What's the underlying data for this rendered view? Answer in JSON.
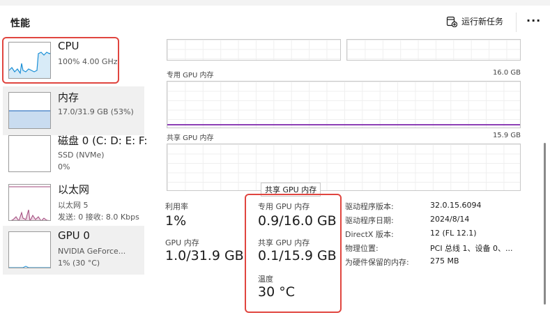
{
  "header": {
    "title": "性能",
    "run_task_label": "运行新任务",
    "more_label": "···"
  },
  "sidebar": {
    "items": [
      {
        "title": "CPU",
        "sub1": "100%  4.00 GHz",
        "sub2": ""
      },
      {
        "title": "内存",
        "sub1": "17.0/31.9 GB (53%)",
        "sub2": ""
      },
      {
        "title": "磁盘 0 (C: D: E: F:",
        "sub1": "SSD (NVMe)",
        "sub2": "0%"
      },
      {
        "title": "以太网",
        "sub1": "以太网 5",
        "sub2": "发送: 0 接收: 8.0 Kbps"
      },
      {
        "title": "GPU 0",
        "sub1": "NVIDIA GeForce...",
        "sub2": "1% (30 °C)"
      }
    ]
  },
  "graphs": {
    "dedicated_label": "专用 GPU 内存",
    "dedicated_max": "16.0 GB",
    "shared_label": "共享 GPU 内存",
    "shared_max": "15.9 GB"
  },
  "tooltip": "共享 GPU 内存",
  "stats": {
    "utilization_label": "利用率",
    "utilization_value": "1%",
    "gpu_mem_label": "GPU 内存",
    "gpu_mem_value": "1.0/31.9 GB",
    "dedicated_label": "专用 GPU 内存",
    "dedicated_value": "0.9/16.0 GB",
    "shared_label": "共享 GPU 内存",
    "shared_value": "0.1/15.9 GB",
    "temp_label": "温度",
    "temp_value": "30 °C"
  },
  "properties": [
    {
      "label": "驱动程序版本:",
      "value": "32.0.15.6094"
    },
    {
      "label": "驱动程序日期:",
      "value": "2024/8/14"
    },
    {
      "label": "DirectX 版本:",
      "value": "12 (FL 12.1)"
    },
    {
      "label": "物理位置:",
      "value": "PCI 总线 1、设备 0、..."
    },
    {
      "label": "为硬件保留的内存:",
      "value": "275 MB"
    }
  ],
  "colors": {
    "highlight": "#e0453f",
    "cpu_line": "#1a8fd6",
    "mem_fill": "#c9dcf0",
    "mem_line": "#3a78c2",
    "net_line": "#a0467a",
    "shared_line": "#8c3fb5"
  }
}
